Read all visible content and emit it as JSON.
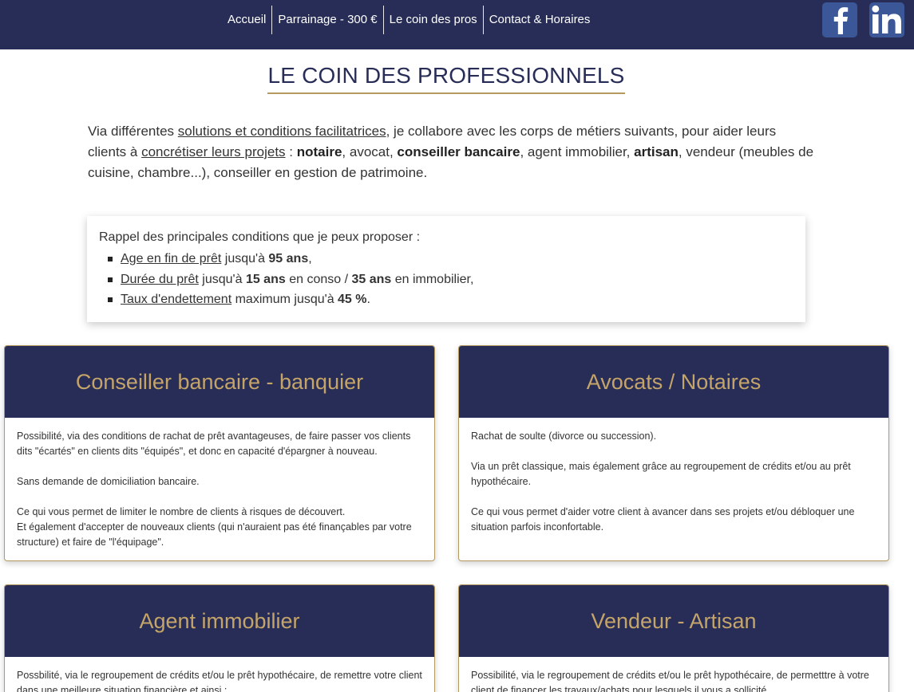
{
  "nav": {
    "items": [
      "Accueil",
      "Parrainage - 300 €",
      "Le coin des pros",
      "Contact & Horaires"
    ],
    "facebook_icon": "facebook-icon",
    "linkedin_icon": "linkedin-icon"
  },
  "colors": {
    "navy": "#272d56",
    "gold": "#c5a46a",
    "gold_border": "#b49a5e"
  },
  "title": "LE COIN DES PROFESSIONNELS",
  "intro": {
    "t1": "Via différentes ",
    "u1": "solutions et conditions facilitatrices",
    "t2": ", je collabore avec les corps de métiers suivants, pour aider leurs clients à ",
    "u2": "concrétiser leurs projets",
    "t3": " : ",
    "b1": "notaire",
    "t4": ", avocat, ",
    "b2": "conseiller bancaire",
    "t5": ", agent immobilier, ",
    "b3": "artisan",
    "t6": ", vendeur (meubles de cuisine, chambre...), conseiller en gestion de patrimoine."
  },
  "conditions": {
    "lead": "Rappel des principales conditions que je peux proposer :",
    "items": [
      {
        "u": "Age en fin de prêt",
        "t1": " jusqu'à ",
        "b1": "95 ans",
        "t2": ",",
        "b2": "",
        "t3": ""
      },
      {
        "u": "Durée du prêt",
        "t1": " jusqu'à ",
        "b1": "15 ans",
        "t2": " en conso / ",
        "b2": "35 ans",
        "t3": " en immobilier,"
      },
      {
        "u": "Taux d'endettement",
        "t1": " maximum jusqu'à ",
        "b1": "45 %",
        "t2": ".",
        "b2": "",
        "t3": ""
      }
    ]
  },
  "cards": [
    {
      "title": "Conseiller bancaire - banquier",
      "p1": "Possibilité, via des conditions de rachat de prêt avantageuses, de faire passer vos clients dits \"écartés\" en clients dits \"équipés\", et donc en capacité d'épargner à nouveau.",
      "p2": "Sans demande de domiciliation bancaire.",
      "p3a": "Ce qui vous permet de limiter le nombre de clients à risques de découvert.",
      "p3b": "Et également d'accepter de nouveaux clients (qui n'auraient pas été finançables par votre structure) et faire de \"l'équipage\"."
    },
    {
      "title": "Avocats / Notaires",
      "p1": "Rachat de soulte (divorce ou succession).",
      "p2": "Via un prêt classique, mais également grâce au regroupement de crédits et/ou au prêt hypothécaire.",
      "p3a": "Ce qui vous permet d'aider votre client à avancer dans ses projets et/ou débloquer une situation parfois inconfortable.",
      "p3b": ""
    },
    {
      "title": "Agent immobilier",
      "p1": "Possbilité, via le regroupement de crédits et/ou le prêt hypothécaire, de remettre votre client dans une meilleure situation financière et ainsi :"
    },
    {
      "title": "Vendeur - Artisan",
      "p1": "Possibilité, via le regroupement de crédits et/ou le prêt hypothécaire, de permetttre à votre client de financer les travaux/achats pour lesquels il vous a sollicité."
    }
  ]
}
